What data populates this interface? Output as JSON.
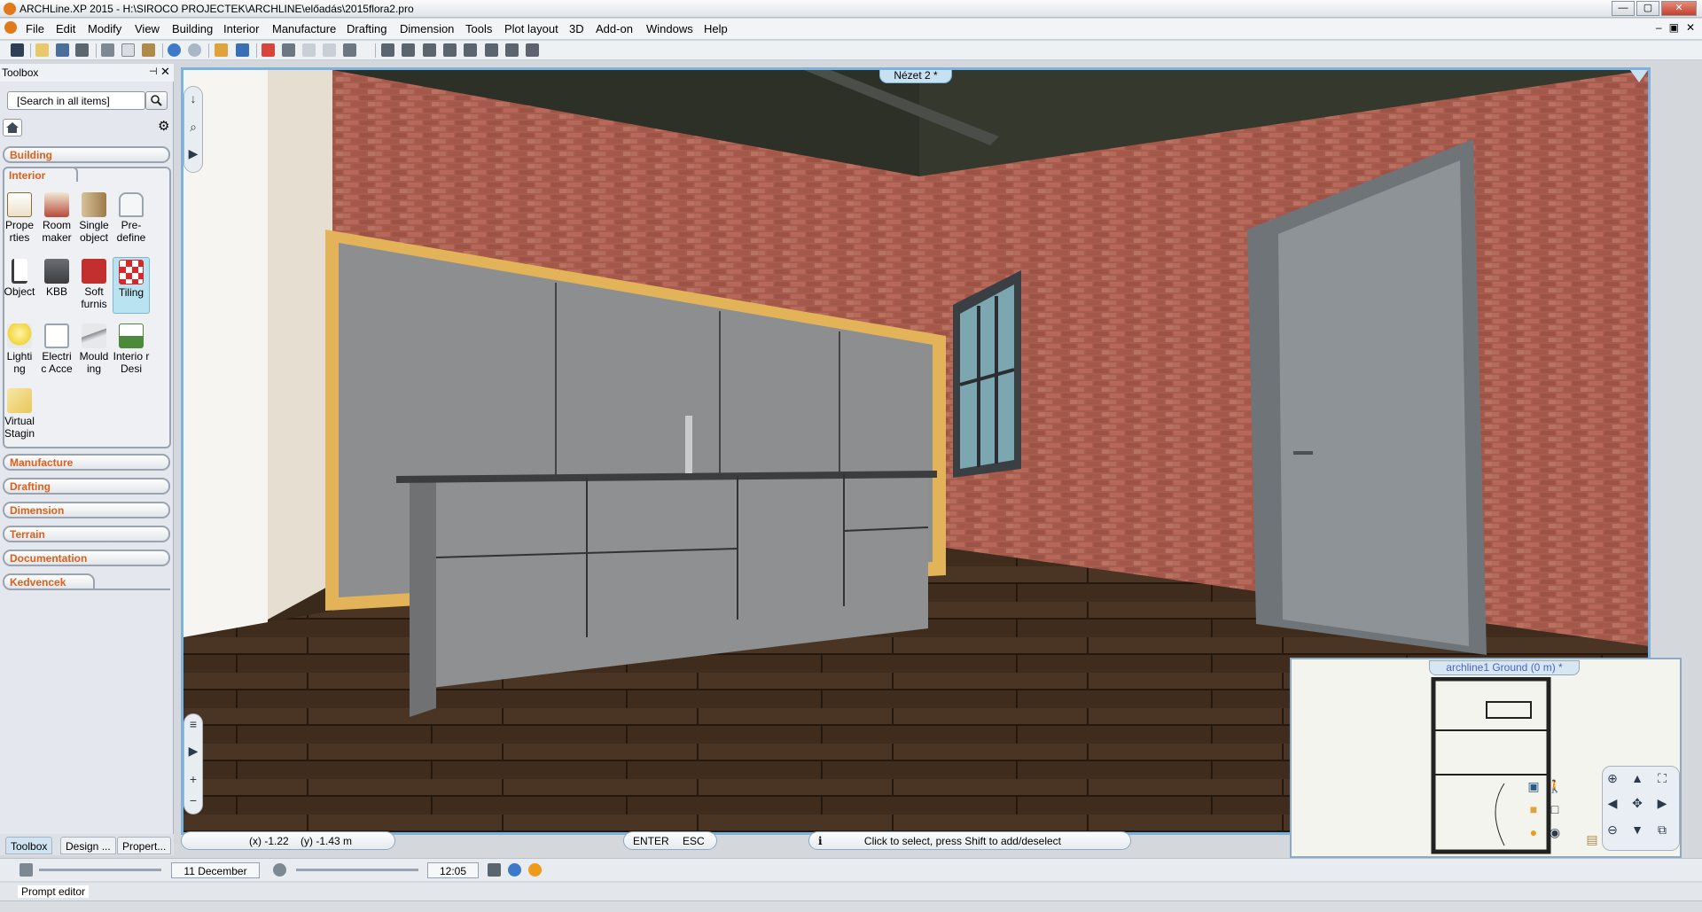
{
  "window": {
    "title": "ARCHLine.XP 2015 - H:\\SIROCO PROJECTEK\\ARCHLINE\\előadás\\2015flora2.pro",
    "controls": [
      "—",
      "▢",
      "✕"
    ],
    "mdi_controls": [
      "–",
      "▣",
      "✕"
    ]
  },
  "menu": [
    "File",
    "Edit",
    "Modify",
    "View",
    "Building",
    "Interior",
    "Manufacture",
    "Drafting",
    "Dimension",
    "Tools",
    "Plot layout",
    "3D",
    "Add-on",
    "Windows",
    "Help"
  ],
  "toolbox": {
    "title": "Toolbox",
    "pin": "⊣",
    "close": "✕",
    "search_placeholder": "[Search in all items]",
    "categories": {
      "building": "Building",
      "interior": "Interior",
      "manufacture": "Manufacture",
      "drafting": "Drafting",
      "dimension": "Dimension",
      "terrain": "Terrain",
      "documentation": "Documentation",
      "kedvencek": "Kedvencek"
    },
    "tools": [
      {
        "label": "Prope rties",
        "icon": "properties-icon",
        "color": "#8a6b3a"
      },
      {
        "label": "Room maker",
        "icon": "room-maker-icon",
        "color": "#b84a3a"
      },
      {
        "label": "Single object",
        "icon": "single-object-icon",
        "color": "#9c7a4a"
      },
      {
        "label": "Pre- define",
        "icon": "predefine-icon",
        "color": "#9aa4b0"
      },
      {
        "label": "Object",
        "icon": "chair-icon",
        "color": "#3c3c3c"
      },
      {
        "label": "KBB",
        "icon": "kbb-icon",
        "color": "#3c3c3c"
      },
      {
        "label": "Soft furnis",
        "icon": "soft-furnishing-icon",
        "color": "#c22f2f"
      },
      {
        "label": "Tiling",
        "icon": "tiling-icon",
        "color": "#d8262b"
      },
      {
        "label": "Lighti ng",
        "icon": "lightbulb-icon",
        "color": "#f2d53c"
      },
      {
        "label": "Electri c Acce",
        "icon": "electric-icon",
        "color": "#9aa4b0"
      },
      {
        "label": "Mould ing",
        "icon": "moulding-icon",
        "color": "#8a8f96"
      },
      {
        "label": "Interio r Desi",
        "icon": "interior-design-icon",
        "color": "#4a8a3a"
      },
      {
        "label": "Virtual Stagin",
        "icon": "virtual-staging-icon",
        "color": "#e8c75a"
      }
    ],
    "bottom_tabs": [
      "Toolbox",
      "Design ...",
      "Propert..."
    ]
  },
  "view": {
    "title": "Nézet 2 *"
  },
  "status": {
    "coord_x": "(x) -1.22",
    "coord_y": "(y) -1.43 m",
    "enter": "ENTER",
    "esc": "ESC",
    "info_icon": "i",
    "hint": "Click to select, press Shift to add/deselect"
  },
  "minimap": {
    "title": "archline1 Ground (0 m) *"
  },
  "timebar": {
    "date": "11 December",
    "time": "12:05"
  },
  "prompt": {
    "label": "Prompt editor"
  },
  "colors": {
    "accent_orange": "#d8611b",
    "viewport_border": "#7ab4de",
    "selected_tool": "#b9e3f1"
  }
}
